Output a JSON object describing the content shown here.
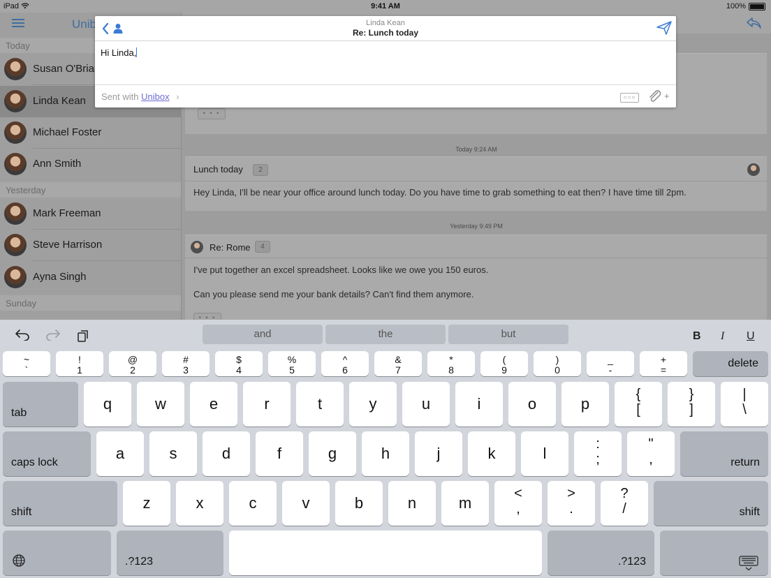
{
  "status": {
    "device": "iPad",
    "time": "9:41 AM",
    "battery": "100%"
  },
  "sidebar": {
    "title": "Unib",
    "sections": {
      "today": "Today",
      "yesterday": "Yesterday",
      "sunday": "Sunday"
    },
    "contacts": [
      {
        "name": "Susan O'Brian"
      },
      {
        "name": "Linda Kean"
      },
      {
        "name": "Michael Foster"
      },
      {
        "name": "Ann Smith"
      },
      {
        "name": "Mark Freeman"
      },
      {
        "name": "Steve Harrison"
      },
      {
        "name": "Ayna Singh"
      }
    ]
  },
  "messages": {
    "top_dots": "• • •",
    "ts1": "Today 9:24 AM",
    "m1": {
      "title": "Lunch today",
      "badge": "2",
      "body": "Hey Linda, I'll be near your office around lunch today. Do you have time to grab something to eat then? I have time till 2pm."
    },
    "ts2": "Yesterday 9:49 PM",
    "m2": {
      "title": "Re: Rome",
      "badge": "4",
      "line1": "I've put together an excel spreadsheet. Looks like we owe you 150 euros.",
      "line2": "Can you please send me your bank details? Can't find them anymore.",
      "dots": "• • •"
    }
  },
  "compose": {
    "to": "Linda Kean",
    "subject": "Re: Lunch today",
    "body": "Hi Linda,",
    "sent_with": "Sent with",
    "sent_link": "Unibox",
    "more": "○○○",
    "plus": "+"
  },
  "keyboard": {
    "suggestions": [
      "and",
      "the",
      "but"
    ],
    "format": {
      "bold": "B",
      "italic": "I",
      "underline": "U"
    },
    "row1": [
      {
        "top": "~",
        "bot": "`"
      },
      {
        "top": "!",
        "bot": "1"
      },
      {
        "top": "@",
        "bot": "2"
      },
      {
        "top": "#",
        "bot": "3"
      },
      {
        "top": "$",
        "bot": "4"
      },
      {
        "top": "%",
        "bot": "5"
      },
      {
        "top": "^",
        "bot": "6"
      },
      {
        "top": "&",
        "bot": "7"
      },
      {
        "top": "*",
        "bot": "8"
      },
      {
        "top": "(",
        "bot": "9"
      },
      {
        "top": ")",
        "bot": "0"
      },
      {
        "top": "_",
        "bot": "-"
      },
      {
        "top": "+",
        "bot": "="
      }
    ],
    "delete": "delete",
    "tab": "tab",
    "row2": [
      "q",
      "w",
      "e",
      "r",
      "t",
      "y",
      "u",
      "i",
      "o",
      "p"
    ],
    "row2_sym": [
      {
        "top": "{",
        "bot": "["
      },
      {
        "top": "}",
        "bot": "]"
      },
      {
        "top": "|",
        "bot": "\\"
      }
    ],
    "caps": "caps lock",
    "row3": [
      "a",
      "s",
      "d",
      "f",
      "g",
      "h",
      "j",
      "k",
      "l"
    ],
    "row3_sym": [
      {
        "top": ":",
        "bot": ";"
      },
      {
        "top": "\"",
        "bot": ","
      }
    ],
    "return": "return",
    "shift": "shift",
    "row4": [
      "z",
      "x",
      "c",
      "v",
      "b",
      "n",
      "m"
    ],
    "row4_sym": [
      {
        "top": "<",
        "bot": ","
      },
      {
        "top": ">",
        "bot": "."
      },
      {
        "top": "?",
        "bot": "/"
      }
    ],
    "num": ".?123"
  }
}
